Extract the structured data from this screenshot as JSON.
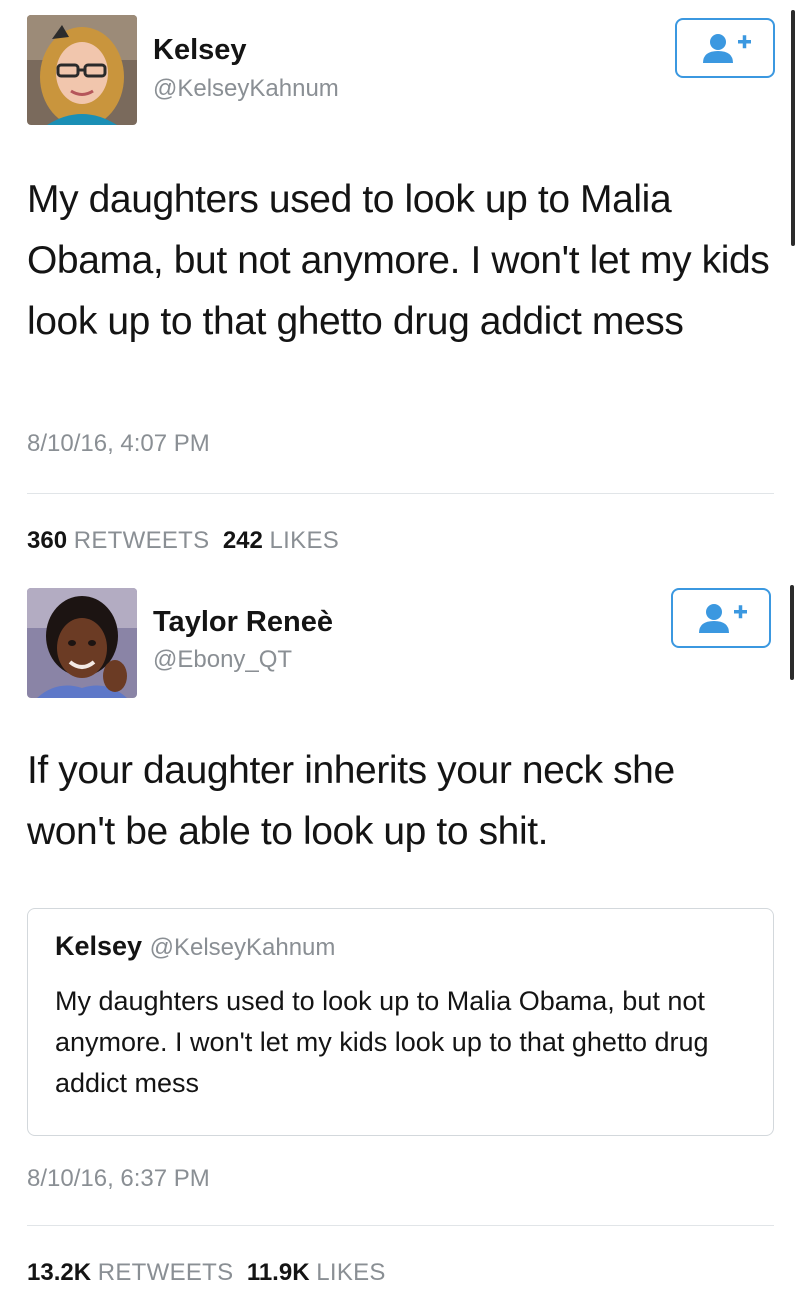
{
  "tweet1": {
    "name": "Kelsey",
    "handle": "@KelseyKahnum",
    "text": "My daughters used to look up to Malia Obama, but not anymore. I won't let my kids look up to that ghetto drug addict mess",
    "timestamp": "8/10/16, 4:07 PM",
    "retweets": "360",
    "retweets_label": "RETWEETS",
    "likes": "242",
    "likes_label": "LIKES",
    "avatar_icon": "user-avatar-photo",
    "follow_icon": "add-user-icon"
  },
  "tweet2": {
    "name": "Taylor Reneè",
    "handle": "@Ebony_QT",
    "text": "If your daughter inherits your neck she won't be able to look up to shit.",
    "timestamp": "8/10/16, 6:37 PM",
    "retweets": "13.2K",
    "retweets_label": "RETWEETS",
    "likes": "11.9K",
    "likes_label": "LIKES",
    "avatar_icon": "user-avatar-photo",
    "follow_icon": "add-user-icon",
    "quoted": {
      "name": "Kelsey",
      "handle": "@KelseyKahnum",
      "text": "My daughters used to look up to Malia Obama, but not anymore. I won't let my kids look up to that ghetto drug addict mess"
    }
  },
  "colors": {
    "accent": "#3b98e0",
    "text": "#141414",
    "secondary": "#8a8f94",
    "divider": "#e1e5e8"
  }
}
